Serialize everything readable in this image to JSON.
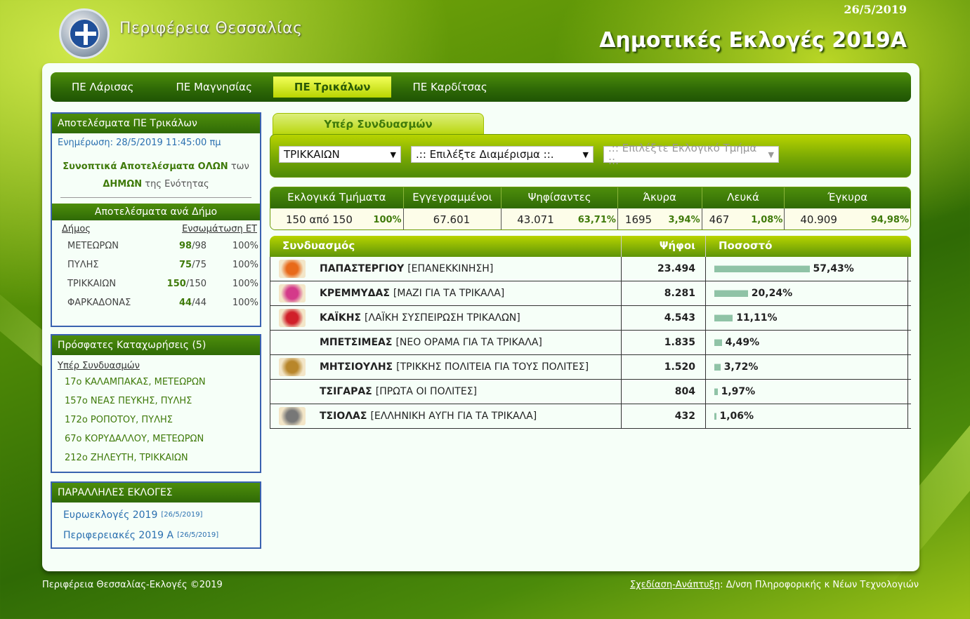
{
  "header": {
    "region_name": "Περιφέρεια Θεσσαλίας",
    "date": "26/5/2019",
    "title": "Δημοτικές Εκλογές 2019Α"
  },
  "nav": {
    "tabs": [
      {
        "label": "ΠΕ Λάρισας"
      },
      {
        "label": "ΠΕ Μαγνησίας"
      },
      {
        "label": "ΠΕ Τρικάλων"
      },
      {
        "label": "ΠΕ Καρδίτσας"
      }
    ]
  },
  "sidebar": {
    "results_title": "Αποτελέσματα ΠΕ Τρικάλων",
    "update": "Ενημέρωση: 28/5/2019 11:45:00 πμ",
    "summary_bold1": "Συνοπτικά Αποτελέσματα ΟΛΩΝ",
    "summary_t1": "των",
    "summary_bold2": "ΔΗΜΩΝ",
    "summary_t2": "της Ενότητας",
    "per_municipality_title": "Αποτελέσματα ανά Δήμο",
    "col_municipality": "Δήμος",
    "col_incorporation": "Ενσωμάτωση ΕΤ",
    "municipalities": [
      {
        "name": "ΜΕΤΕΩΡΩΝ",
        "done": "98",
        "total": "/98",
        "pct": "100%"
      },
      {
        "name": "ΠΥΛΗΣ",
        "done": "75",
        "total": "/75",
        "pct": "100%"
      },
      {
        "name": "ΤΡΙΚΚΑΙΩΝ",
        "done": "150",
        "total": "/150",
        "pct": "100%"
      },
      {
        "name": "ΦΑΡΚΑΔΟΝΑΣ",
        "done": "44",
        "total": "/44",
        "pct": "100%"
      }
    ],
    "recent_title": "Πρόσφατες Καταχωρήσεις (5)",
    "recent_link": "Υπέρ Συνδυασμών",
    "recent_entries": [
      "17ο ΚΑΛΑΜΠΑΚΑΣ, ΜΕΤΕΩΡΩΝ",
      "157ο ΝΕΑΣ ΠΕΥΚΗΣ, ΠΥΛΗΣ",
      "172ο ΡΟΠΟΤΟΥ, ΠΥΛΗΣ",
      "67ο ΚΟΡΥΔΑΛΛΟΥ, ΜΕΤΕΩΡΩΝ",
      "212ο ΖΗΛΕΥΤΗ, ΤΡΙΚΚΑΙΩΝ"
    ],
    "parallel_title": "ΠΑΡΑΛΛΗΛΕΣ ΕΚΛΟΓΕΣ",
    "parallel": [
      {
        "label": "Ευρωεκλογές 2019",
        "date": "[26/5/2019]"
      },
      {
        "label": "Περιφερειακές 2019 Α",
        "date": "[26/5/2019]"
      }
    ]
  },
  "content": {
    "tab_label": "Υπέρ Συνδυασμών",
    "filters": {
      "municipality": "ΤΡΙΚΚΑΙΩΝ",
      "district": ".:: Επιλέξτε Διαμέρισμα ::.",
      "station": ".:: Επιλέξτε Εκλογικό Τμήμα ::."
    },
    "stats_headers": [
      "Εκλογικά Τμήματα",
      "Εγγεγραμμένοι",
      "Ψηφίσαντες",
      "Άκυρα",
      "Λευκά",
      "Έγκυρα"
    ],
    "stats": [
      {
        "value": "150 από 150",
        "pct": "100%"
      },
      {
        "value": "67.601",
        "pct": ""
      },
      {
        "value": "43.071",
        "pct": "63,71%"
      },
      {
        "value": "1695",
        "pct": "3,94%"
      },
      {
        "value": "467",
        "pct": "1,08%"
      },
      {
        "value": "40.909",
        "pct": "94,98%"
      }
    ],
    "results_headers": {
      "combo": "Συνδυασμός",
      "votes": "Ψήφοι",
      "pct": "Ποσοστό"
    },
    "results": [
      {
        "surname": "ΠΑΠΑΣΤΕΡΓΙΟΥ",
        "party": "[ΕΠΑΝΕΚΚΙΝΗΣΗ]",
        "votes": "23.494",
        "pct": "57,43%",
        "share": 57.43,
        "logo": "sun-logo",
        "logo_color": "#e86a1a"
      },
      {
        "surname": "ΚΡΕΜΜΥΔΑΣ",
        "party": "[ΜΑΖΙ ΓΙΑ ΤΑ ΤΡΙΚΑΛΑ]",
        "votes": "8.281",
        "pct": "20,24%",
        "share": 20.24,
        "logo": "colorful-logo",
        "logo_color": "#d43a8a"
      },
      {
        "surname": "ΚΑΪΚΗΣ",
        "party": "[ΛΑΪΚΗ ΣΥΣΠΕΙΡΩΣΗ ΤΡΙΚΑΛΩΝ]",
        "votes": "4.543",
        "pct": "11,11%",
        "share": 11.11,
        "logo": "red-logo",
        "logo_color": "#d0202a"
      },
      {
        "surname": "ΜΠΕΤΣΙΜΕΑΣ",
        "party": "[ΝΕΟ ΟΡΑΜΑ ΓΙΑ ΤΑ ΤΡΙΚΑΛΑ]",
        "votes": "1.835",
        "pct": "4,49%",
        "share": 4.49,
        "logo": "",
        "logo_color": ""
      },
      {
        "surname": "ΜΗΤΣΙΟΥΛΗΣ",
        "party": "[ΤΡΙΚΚΗΣ ΠΟΛΙΤΕΙΑ ΓΙΑ ΤΟΥΣ ΠΟΛΙΤΕΣ]",
        "votes": "1.520",
        "pct": "3,72%",
        "share": 3.72,
        "logo": "gold-logo",
        "logo_color": "#b8862a"
      },
      {
        "surname": "ΤΣΙΓΑΡΑΣ",
        "party": "[ΠΡΩΤΑ ΟΙ ΠΟΛΙΤΕΣ]",
        "votes": "804",
        "pct": "1,97%",
        "share": 1.97,
        "logo": "",
        "logo_color": ""
      },
      {
        "surname": "ΤΣΙΟΛΑΣ",
        "party": "[ΕΛΛΗΝΙΚΗ ΑΥΓΗ ΓΙΑ ΤΑ ΤΡΙΚΑΛΑ]",
        "votes": "432",
        "pct": "1,06%",
        "share": 1.06,
        "logo": "meander-logo",
        "logo_color": "#777777"
      }
    ]
  },
  "footer": {
    "left": "Περιφέρεια Θεσσαλίας-Εκλογές ©2019",
    "right_link": "Σχεδίαση-Ανάπτυξη",
    "right_text": ": Δ/νση Πληροφορικής κ Νέων Τεχνολογιών"
  }
}
